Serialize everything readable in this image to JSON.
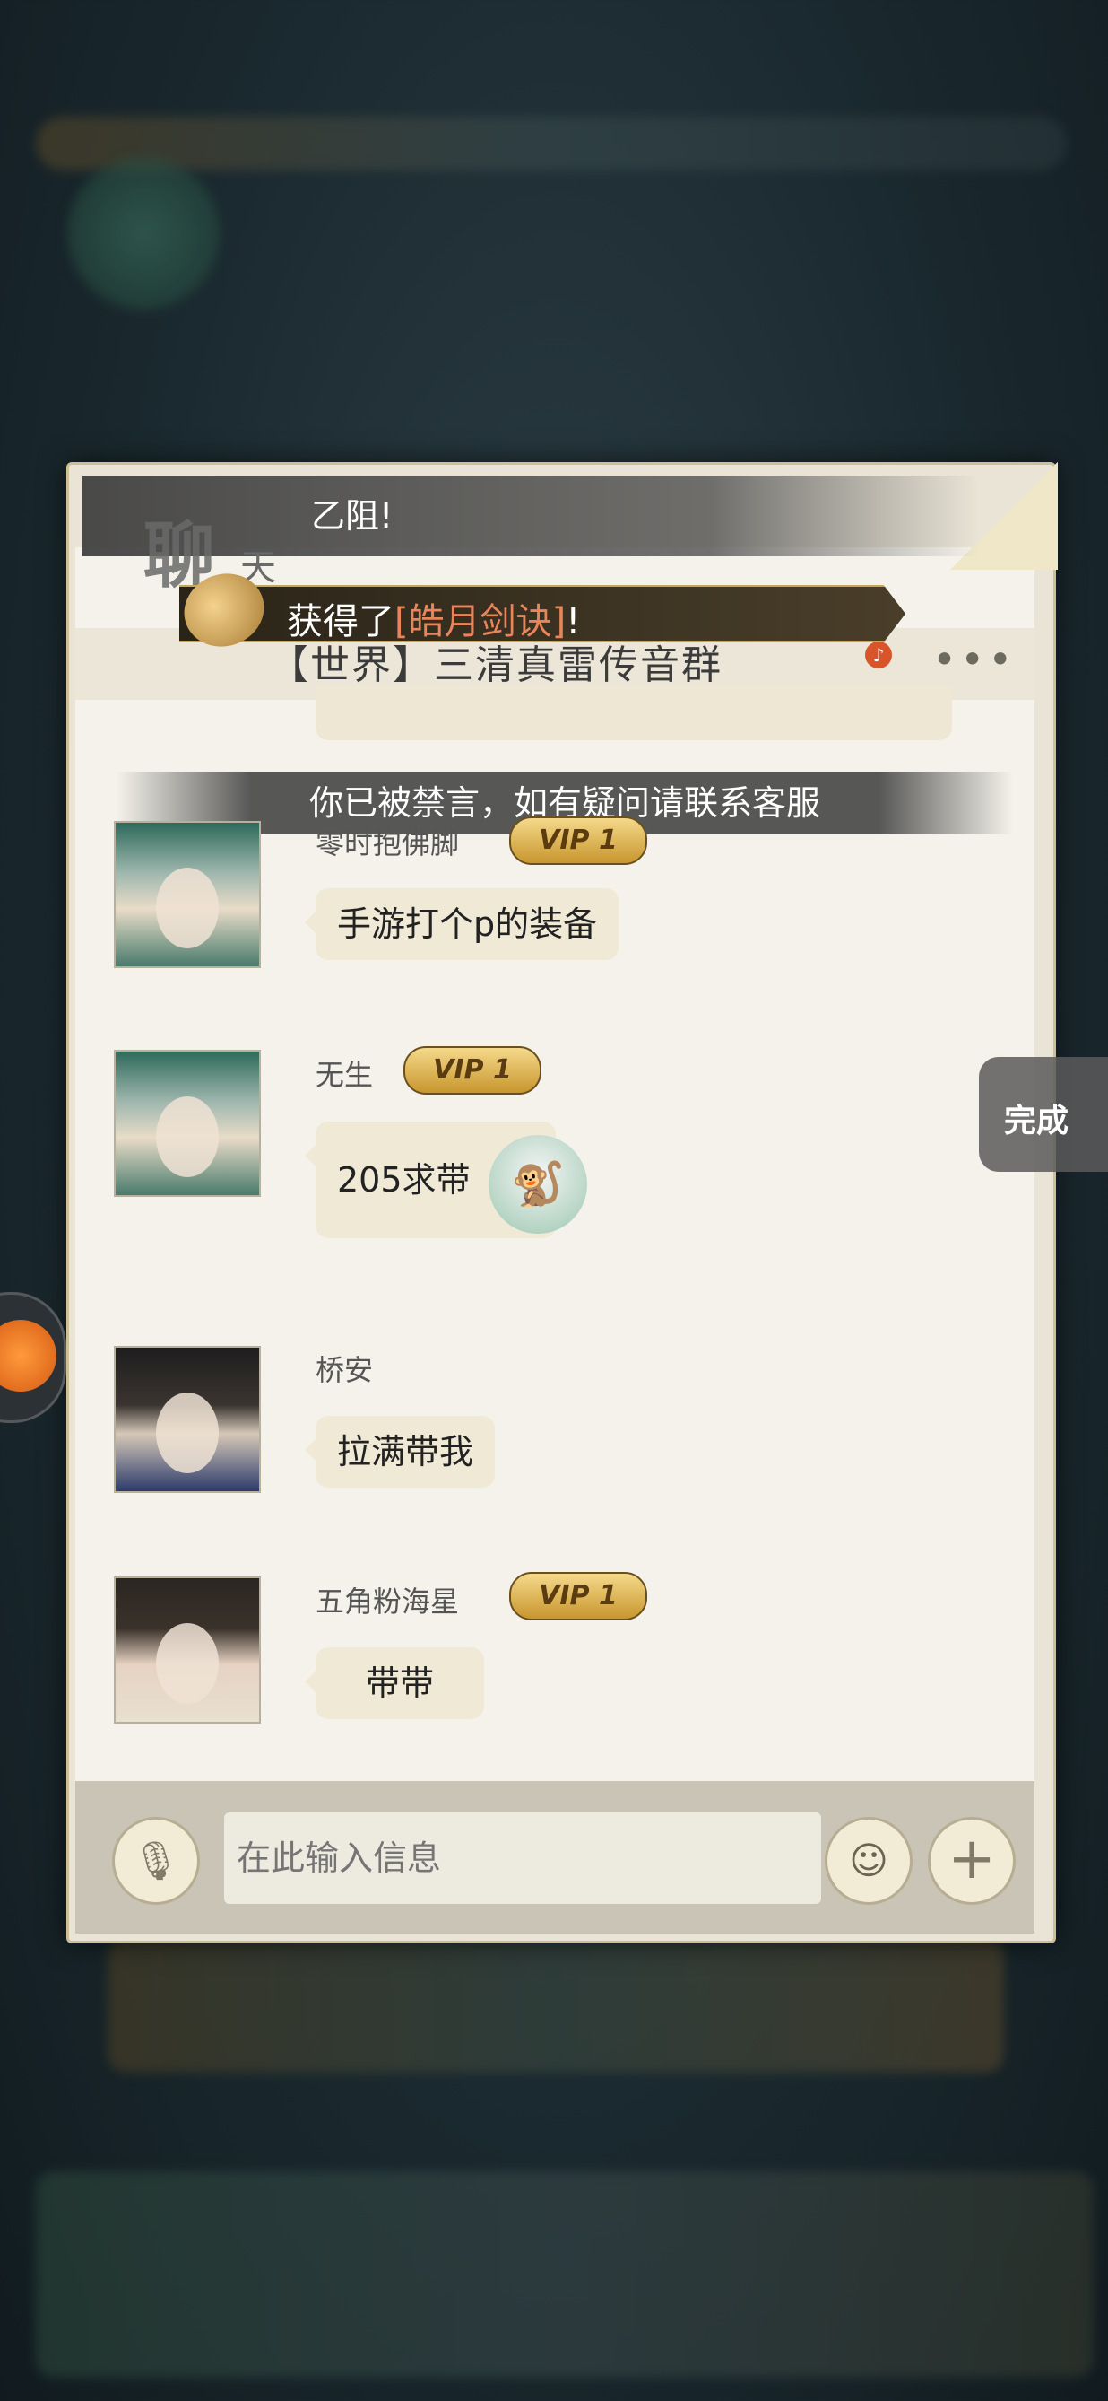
{
  "header": {
    "title_deco": "聊",
    "title_deco2": "天",
    "system_msg_tail": "乙阻!",
    "announce_prefix": "获得了",
    "announce_item": "[皓月剑诀]",
    "announce_suffix": "!",
    "channel": "【世界】三清真雷传音群",
    "more": "•••"
  },
  "ban_notice": "你已被禁言，如有疑问请联系客服",
  "messages": [
    {
      "name": "零时抱佛脚",
      "vip": "VIP 1",
      "text": "手游打个p的装备",
      "avatar": "avatar-silver-hair"
    },
    {
      "name": "无生",
      "vip": "VIP 1",
      "text": "205求带",
      "sticker": "monkey-sticker",
      "avatar": "avatar-silver-hair"
    },
    {
      "name": "桥安",
      "vip": "",
      "text": "拉满带我",
      "avatar": "avatar-black-hair"
    },
    {
      "name": "五角粉海星",
      "vip": "VIP 1",
      "text": "带带",
      "avatar": "avatar-female"
    }
  ],
  "input": {
    "placeholder": "在此输入信息"
  },
  "done_button": "完成",
  "icons": {
    "mic": "mic-icon",
    "emoji": "emoji-icon",
    "plus": "plus-icon",
    "mute": "mute-icon"
  },
  "colors": {
    "highlight": "#e8855a",
    "vip_gold": "#c8962e",
    "panel_bg": "#f4f2ea"
  }
}
